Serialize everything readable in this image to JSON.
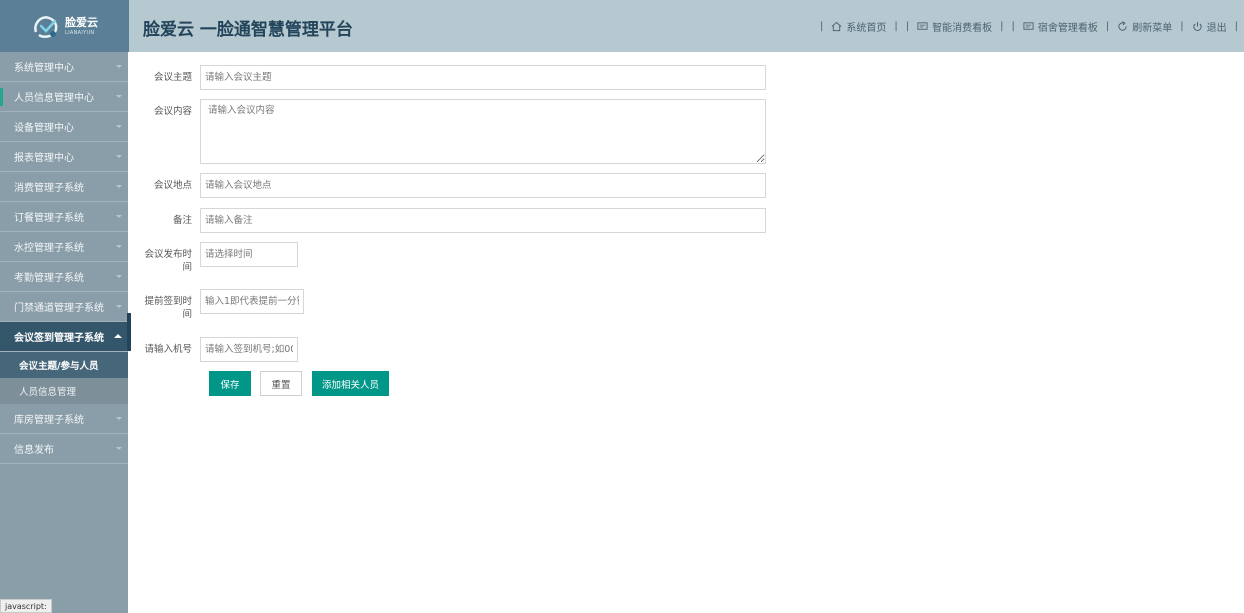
{
  "header": {
    "logo_cn": "脸爱云",
    "logo_en": "LIANAIYUN",
    "title": "脸爱云 一脸通智慧管理平台",
    "nav": {
      "home": "系统首页",
      "consume_board": "智能消费看板",
      "dorm_board": "宿舍管理看板",
      "refresh": "刷新菜单",
      "logout": "退出"
    }
  },
  "sidebar": {
    "items": [
      {
        "label": "系统管理中心"
      },
      {
        "label": "人员信息管理中心"
      },
      {
        "label": "设备管理中心"
      },
      {
        "label": "报表管理中心"
      },
      {
        "label": "消费管理子系统"
      },
      {
        "label": "订餐管理子系统"
      },
      {
        "label": "水控管理子系统"
      },
      {
        "label": "考勤管理子系统"
      },
      {
        "label": "门禁通道管理子系统"
      },
      {
        "label": "会议签到管理子系统"
      },
      {
        "label": "库房管理子系统"
      },
      {
        "label": "信息发布"
      }
    ],
    "subitems": [
      {
        "label": "会议主题/参与人员"
      },
      {
        "label": "人员信息管理"
      }
    ]
  },
  "form": {
    "topic": {
      "label": "会议主题",
      "placeholder": "请输入会议主题"
    },
    "content": {
      "label": "会议内容",
      "placeholder": "请输入会议内容"
    },
    "location": {
      "label": "会议地点",
      "placeholder": "请输入会议地点"
    },
    "remark": {
      "label": "备注",
      "placeholder": "请输入备注"
    },
    "publish_time": {
      "label": "会议发布时间",
      "placeholder": "请选择时间"
    },
    "advance_checkin": {
      "label": "提前签到时间",
      "placeholder": "输入1即代表提前一分钟"
    },
    "machine_no": {
      "label": "请输入机号",
      "placeholder": "请输入签到机号;如001"
    }
  },
  "buttons": {
    "save": "保存",
    "reset": "重置",
    "add_people": "添加相关人员"
  },
  "status_bar": "javascript:",
  "colors": {
    "header_bg": "#b7c9d0",
    "sidebar_bg": "#8a9ea9",
    "active_menu": "#34566b",
    "primary": "#009688"
  }
}
